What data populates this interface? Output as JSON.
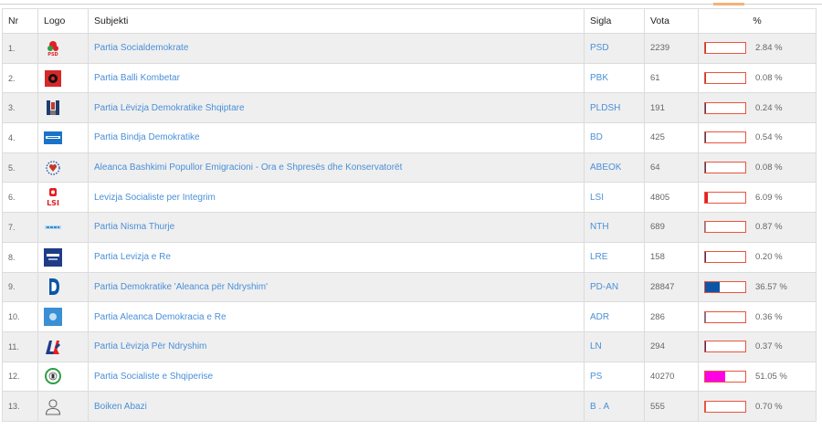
{
  "table": {
    "headers": {
      "nr": "Nr",
      "logo": "Logo",
      "subjekti": "Subjekti",
      "sigla": "Sigla",
      "vota": "Vota",
      "pct": "%"
    },
    "rows": [
      {
        "nr": "1.",
        "logo_icon": "psd-logo-icon",
        "subjekti": "Partia Socialdemokrate",
        "sigla": "PSD",
        "vota": "2239",
        "pct": "2.84 %",
        "fraction": 0.0284,
        "bar_color": "#c0392b"
      },
      {
        "nr": "2.",
        "logo_icon": "pbk-logo-icon",
        "subjekti": "Partia Balli Kombetar",
        "sigla": "PBK",
        "vota": "61",
        "pct": "0.08 %",
        "fraction": 0.0008,
        "bar_color": "#c0392b"
      },
      {
        "nr": "3.",
        "logo_icon": "pldsh-logo-icon",
        "subjekti": "Partia Lëvizja Demokratike Shqiptare",
        "sigla": "PLDSH",
        "vota": "191",
        "pct": "0.24 %",
        "fraction": 0.0024,
        "bar_color": "#1f4e79"
      },
      {
        "nr": "4.",
        "logo_icon": "bd-logo-icon",
        "subjekti": "Partia Bindja Demokratike",
        "sigla": "BD",
        "vota": "425",
        "pct": "0.54 %",
        "fraction": 0.0054,
        "bar_color": "#1f4e79"
      },
      {
        "nr": "5.",
        "logo_icon": "abeok-logo-icon",
        "subjekti": "Aleanca Bashkimi Popullor Emigracioni - Ora e Shpresës dhe Konservatorët",
        "sigla": "ABEOK",
        "vota": "64",
        "pct": "0.08 %",
        "fraction": 0.0008,
        "bar_color": "#1f4e79"
      },
      {
        "nr": "6.",
        "logo_icon": "lsi-logo-icon",
        "subjekti": "Levizja Socialiste per Integrim",
        "sigla": "LSI",
        "vota": "4805",
        "pct": "6.09 %",
        "fraction": 0.0609,
        "bar_color": "#e31e24"
      },
      {
        "nr": "7.",
        "logo_icon": "nth-logo-icon",
        "subjekti": "Partia Nisma Thurje",
        "sigla": "NTH",
        "vota": "689",
        "pct": "0.87 %",
        "fraction": 0.0087,
        "bar_color": "#7aa0c4"
      },
      {
        "nr": "8.",
        "logo_icon": "lre-logo-icon",
        "subjekti": "Partia Levizja e Re",
        "sigla": "LRE",
        "vota": "158",
        "pct": "0.20 %",
        "fraction": 0.002,
        "bar_color": "#1f3c88"
      },
      {
        "nr": "9.",
        "logo_icon": "pd-logo-icon",
        "subjekti": "Partia Demokratike 'Aleanca për Ndryshim'",
        "sigla": "PD-AN",
        "vota": "28847",
        "pct": "36.57 %",
        "fraction": 0.3657,
        "bar_color": "#0d56a6"
      },
      {
        "nr": "10.",
        "logo_icon": "adr-logo-icon",
        "subjekti": "Partia Aleanca Demokracia e Re",
        "sigla": "ADR",
        "vota": "286",
        "pct": "0.36 %",
        "fraction": 0.0036,
        "bar_color": "#3b8fd4"
      },
      {
        "nr": "11.",
        "logo_icon": "ln-logo-icon",
        "subjekti": "Partia Lëvizja Për Ndryshim",
        "sigla": "LN",
        "vota": "294",
        "pct": "0.37 %",
        "fraction": 0.0037,
        "bar_color": "#1f3c88"
      },
      {
        "nr": "12.",
        "logo_icon": "ps-logo-icon",
        "subjekti": "Partia Socialiste e Shqiperise",
        "sigla": "PS",
        "vota": "40270",
        "pct": "51.05 %",
        "fraction": 0.5105,
        "bar_color": "#ff00e6"
      },
      {
        "nr": "13.",
        "logo_icon": "person-icon",
        "subjekti": "Boiken Abazi",
        "sigla": "B . A",
        "vota": "555",
        "pct": "0.70 %",
        "fraction": 0.007,
        "bar_color": "#e8553f"
      }
    ]
  },
  "colors": {
    "link": "#4a8fd8",
    "bar_border": "#e8553f",
    "row_alt": "#efefef",
    "top_accent": "#f2b27a"
  }
}
